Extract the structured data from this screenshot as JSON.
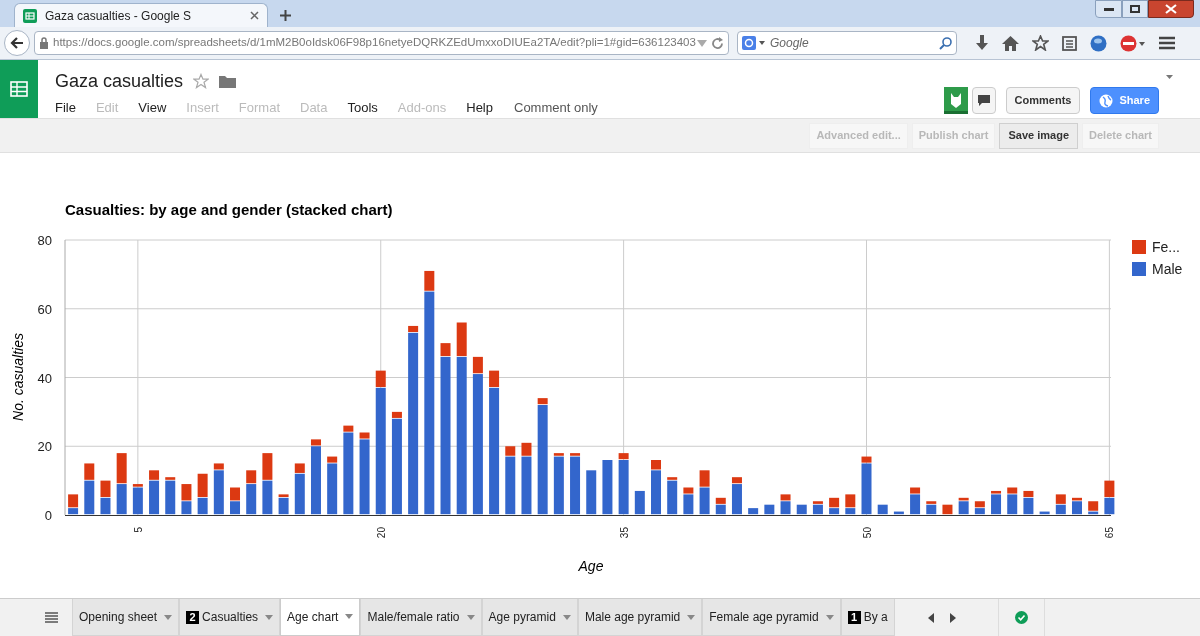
{
  "browser": {
    "tab_title": "Gaza casualties - Google S",
    "url": "https://docs.google.com/spreadsheets/d/1mM2B0oIdsk06F98p16netyeDQRKZEdUmxxoDIUEa2TA/edit?pli=1#gid=636123403",
    "search_placeholder": "Google"
  },
  "doc": {
    "title": "Gaza casualties",
    "menu": [
      {
        "label": "File",
        "disabled": false
      },
      {
        "label": "Edit",
        "disabled": true
      },
      {
        "label": "View",
        "disabled": false
      },
      {
        "label": "Insert",
        "disabled": true
      },
      {
        "label": "Format",
        "disabled": true
      },
      {
        "label": "Data",
        "disabled": true
      },
      {
        "label": "Tools",
        "disabled": false
      },
      {
        "label": "Add-ons",
        "disabled": true
      },
      {
        "label": "Help",
        "disabled": false
      }
    ],
    "access": "Comment only",
    "comments_button": "Comments",
    "share_button": "Share"
  },
  "chart_toolbar": [
    {
      "label": "Advanced edit...",
      "disabled": true
    },
    {
      "label": "Publish chart",
      "disabled": true
    },
    {
      "label": "Save image",
      "disabled": false
    },
    {
      "label": "Delete chart",
      "disabled": true
    }
  ],
  "chart": {
    "chart_data": {
      "type": "bar",
      "title": "Casualties: by age and gender (stacked chart)",
      "xlabel": "Age",
      "ylabel": "No. casualties",
      "stacked": true,
      "x": [
        1,
        2,
        3,
        4,
        5,
        6,
        7,
        8,
        9,
        10,
        11,
        12,
        13,
        14,
        15,
        16,
        17,
        18,
        19,
        20,
        21,
        22,
        23,
        24,
        25,
        26,
        27,
        28,
        29,
        30,
        31,
        32,
        33,
        34,
        35,
        36,
        37,
        38,
        39,
        40,
        41,
        42,
        43,
        44,
        45,
        46,
        47,
        48,
        49,
        50,
        51,
        52,
        53,
        54,
        55,
        56,
        57,
        58,
        59,
        60,
        61,
        62,
        63,
        64,
        65
      ],
      "series": [
        {
          "name": "Male",
          "color": "#3366cc",
          "values": [
            2,
            10,
            5,
            9,
            8,
            10,
            10,
            4,
            5,
            13,
            4,
            9,
            10,
            5,
            12,
            20,
            15,
            24,
            22,
            37,
            28,
            53,
            65,
            46,
            46,
            41,
            37,
            17,
            17,
            32,
            17,
            17,
            13,
            16,
            16,
            7,
            13,
            10,
            6,
            8,
            3,
            9,
            2,
            3,
            4,
            3,
            3,
            2,
            2,
            15,
            3,
            1,
            6,
            3,
            0,
            4,
            2,
            6,
            6,
            5,
            1,
            3,
            4,
            1,
            5
          ]
        },
        {
          "name": "Fe...",
          "color": "#dc3912",
          "values": [
            4,
            5,
            5,
            9,
            1,
            3,
            1,
            5,
            7,
            2,
            4,
            4,
            8,
            1,
            3,
            2,
            2,
            2,
            2,
            5,
            2,
            2,
            6,
            4,
            10,
            5,
            5,
            3,
            4,
            2,
            1,
            1,
            0,
            0,
            2,
            0,
            3,
            1,
            2,
            5,
            2,
            2,
            0,
            0,
            2,
            0,
            1,
            3,
            4,
            2,
            0,
            0,
            2,
            1,
            3,
            1,
            2,
            1,
            2,
            2,
            0,
            3,
            1,
            3,
            5
          ]
        }
      ],
      "xticks": [
        5,
        20,
        35,
        50,
        65
      ],
      "yticks": [
        0,
        20,
        40,
        60,
        80
      ],
      "xlim": [
        0.5,
        65.1
      ],
      "ylim": [
        0,
        80
      ],
      "grid": true,
      "legend": true
    }
  },
  "sheet_tabs": [
    {
      "label": "Opening sheet",
      "selected": false
    },
    {
      "badge": "2",
      "label": "Casualties",
      "selected": false
    },
    {
      "label": "Age chart",
      "selected": true
    },
    {
      "label": "Male/female ratio",
      "selected": false
    },
    {
      "label": "Age pyramid",
      "selected": false
    },
    {
      "label": "Male age pyramid",
      "selected": false
    },
    {
      "label": "Female age pyramid",
      "selected": false
    },
    {
      "badge": "1",
      "label": "By a",
      "selected": false
    }
  ]
}
